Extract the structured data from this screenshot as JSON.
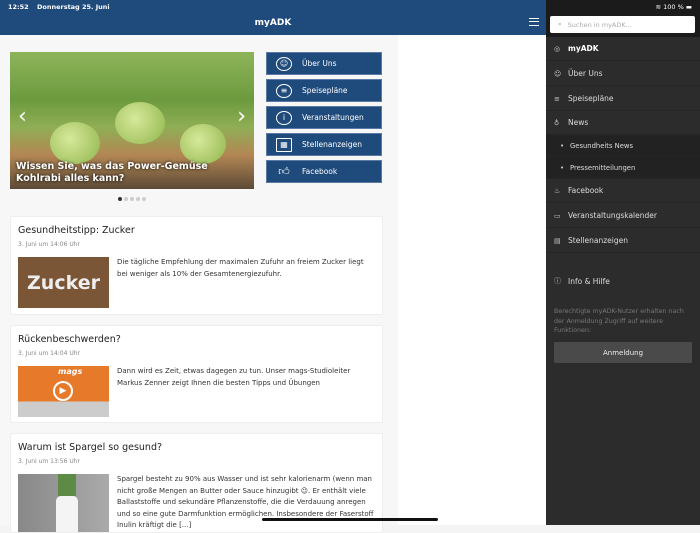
{
  "status_bar": {
    "time": "12:52",
    "date": "Donnerstag 25. Juni",
    "battery": "100 %"
  },
  "header": {
    "title": "myADK"
  },
  "carousel": {
    "caption": "Wissen Sie, was das Power-Gemüse Kohlrabi alles kann?",
    "slide_count": 5,
    "active_slide": 1
  },
  "quick_links": [
    {
      "label": "Über Uns",
      "icon": "people-icon"
    },
    {
      "label": "Speisepläne",
      "icon": "burger-icon"
    },
    {
      "label": "Veranstaltungen",
      "icon": "info-icon"
    },
    {
      "label": "Stellenanzeigen",
      "icon": "calendar-icon"
    },
    {
      "label": "Facebook",
      "icon": "thumbs-up-icon"
    }
  ],
  "news": [
    {
      "title": "Gesundheitstipp: Zucker",
      "date": "3. Juni um 14:06 Uhr",
      "text": "Die tägliche Empfehlung der maximalen Zufuhr an freiem Zucker liegt bei weniger als 10% der Gesamtenergiezufuhr.",
      "thumb_text": "Zucker"
    },
    {
      "title": "Rückenbeschwerden?",
      "date": "3. Juni um 14:04 Uhr",
      "text": "Dann wird es Zeit, etwas dagegen zu tun. Unser mags-Studioleiter Markus Zenner zeigt Ihnen die besten Tipps und Übungen",
      "thumb_text": "mags"
    },
    {
      "title": "Warum ist Spargel so gesund?",
      "date": "3. Juni um 13:56 Uhr",
      "text": "Spargel besteht zu 90% aus Wasser und ist sehr kalorienarm (wenn man nicht große Mengen an Butter oder Sauce hinzugibt 😉. Er enthält viele Ballaststoffe und sekundäre Pflanzenstoffe, die die Verdauung anregen und so eine gute Darmfunktion ermöglichen. Insbesondere der Faserstoff Inulin kräftigt die [...]"
    }
  ],
  "sidebar": {
    "search_placeholder": "Suchen in myADK...",
    "items": [
      {
        "label": "myADK"
      },
      {
        "label": "Über Uns"
      },
      {
        "label": "Speisepläne"
      },
      {
        "label": "News"
      },
      {
        "label": "Gesundheits News"
      },
      {
        "label": "Pressemitteilungen"
      },
      {
        "label": "Facebook"
      },
      {
        "label": "Veranstaltungskalender"
      },
      {
        "label": "Stellenanzeigen"
      },
      {
        "label": "Info & Hilfe"
      }
    ],
    "note": "Berechtigte myADK-Nutzer erhalten nach der Anmeldung Zugriff auf weitere Funktionen:",
    "login_label": "Anmeldung"
  }
}
